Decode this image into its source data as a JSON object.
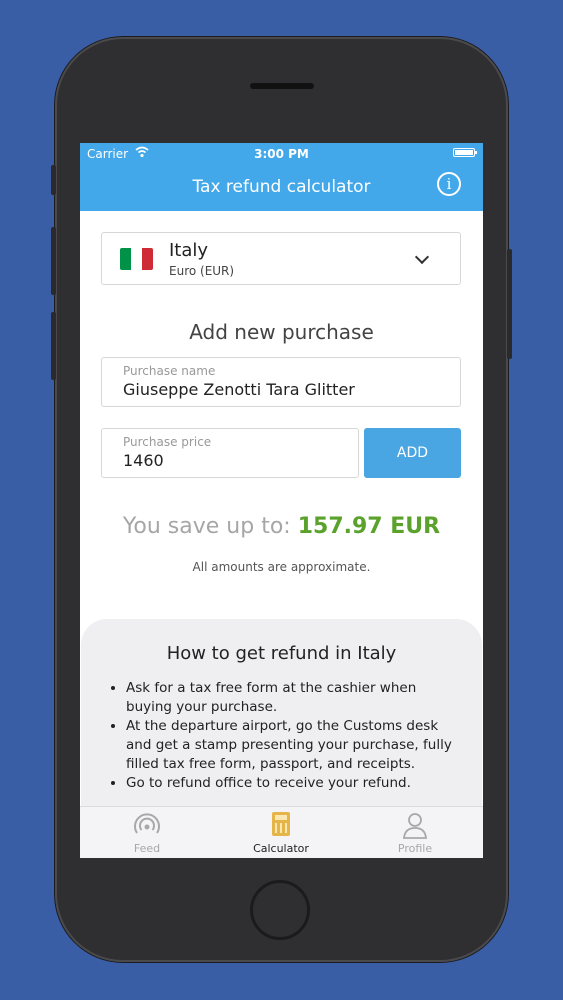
{
  "status_bar": {
    "carrier": "Carrier",
    "time": "3:00 PM"
  },
  "header": {
    "title": "Tax refund calculator",
    "info_glyph": "i"
  },
  "country_selector": {
    "country": "Italy",
    "currency": "Euro (EUR)",
    "flag_colors": [
      "#009246",
      "#ffffff",
      "#ce2b37"
    ]
  },
  "purchase_form": {
    "section_title": "Add new purchase",
    "name_label": "Purchase name",
    "name_value": "Giuseppe Zenotti Tara Glitter",
    "price_label": "Purchase price",
    "price_value": "1460",
    "add_label": "ADD"
  },
  "savings": {
    "prefix": "You save up to:",
    "amount": "157.97 EUR",
    "note": "All amounts are approximate."
  },
  "refund_info": {
    "title": "How to get refund in Italy",
    "steps": [
      "Ask for a tax free form at the cashier when buying your purchase.",
      "At the departure airport, go the Customs desk and get a stamp presenting your purchase, fully filled tax free form, passport, and receipts.",
      "Go to refund office to receive your refund."
    ]
  },
  "tabbar": {
    "tabs": [
      {
        "label": "Feed",
        "icon": "feed-icon",
        "active": false
      },
      {
        "label": "Calculator",
        "icon": "calculator-icon",
        "active": true
      },
      {
        "label": "Profile",
        "icon": "profile-icon",
        "active": false
      }
    ]
  },
  "colors": {
    "accent": "#42a8ea",
    "savings_green": "#5aa22c",
    "background": "#3a5ea6"
  }
}
